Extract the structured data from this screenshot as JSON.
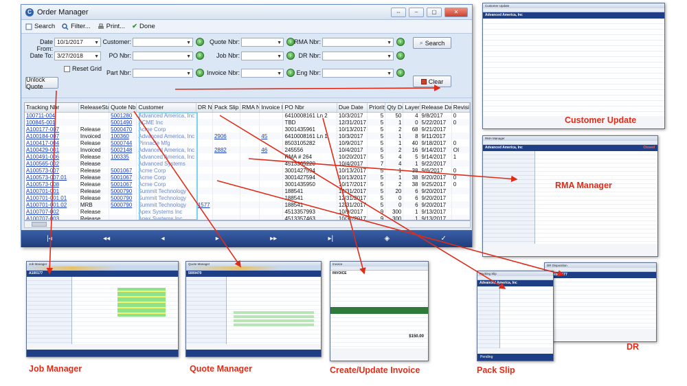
{
  "window": {
    "title": "Order Manager"
  },
  "toolbar": {
    "search": "Search",
    "filter": "Filter...",
    "print": "Print...",
    "done": "Done"
  },
  "filters": {
    "date_from_label": "Date From:",
    "date_from": "10/1/2017",
    "date_to_label": "Date To:",
    "date_to": "3/27/2018",
    "reset_grid": "Reset Grid",
    "customer_label": "Customer:",
    "po_label": "PO Nbr:",
    "part_label": "Part Nbr:",
    "quote_label": "Quote Nbr:",
    "job_label": "Job Nbr:",
    "invoice_label": "Invoice Nbr:",
    "rma_label": "RMA Nbr:",
    "dr_label": "DR Nbr:",
    "eng_label": "Eng Nbr:"
  },
  "buttons": {
    "unlock_quote": "Unlock Quote",
    "search": "Search",
    "clear": "Clear"
  },
  "grid": {
    "columns": [
      "Tracking Nbr",
      "ReleaseStatus",
      "Quote Nbr",
      "Customer",
      "DR Nbr",
      "Pack Slip Nbr",
      "RMA Nbr",
      "Invoice Nbr",
      "PO Nbr",
      "Due Date",
      "Priority",
      "Qty Due",
      "Layers",
      "Release Date",
      "Revision"
    ],
    "rows": [
      [
        "100711-004",
        "",
        "5001280",
        "Advanced America, Inc",
        "",
        "",
        "",
        "",
        "6410008161 Ln 2",
        "10/3/2017",
        "5",
        "50",
        "4",
        "9/8/2017",
        "0"
      ],
      [
        "100845-001",
        "",
        "5001490",
        "ACME Inc",
        "",
        "",
        "",
        "",
        "TBD",
        "12/31/2017",
        "5",
        "1",
        "0",
        "5/22/2017",
        "0"
      ],
      [
        "A100177-007",
        "Release",
        "5000470",
        "Acme Corp",
        "",
        "",
        "",
        "",
        "3001435961",
        "10/13/2017",
        "5",
        "2",
        "68",
        "9/21/2017",
        ""
      ],
      [
        "A100184-007",
        "Invoiced",
        "100360",
        "Advanced America, Inc",
        "",
        "2906",
        "",
        "45",
        "6410008161 Ln 1",
        "10/3/2017",
        "5",
        "1",
        "8",
        "9/11/2017",
        ""
      ],
      [
        "A100417-004",
        "Release",
        "5000744",
        "Pinnacle Mfg",
        "",
        "",
        "",
        "",
        "8503105282",
        "10/9/2017",
        "5",
        "1",
        "40",
        "9/18/2017",
        "0"
      ],
      [
        "A100429-001",
        "Invoiced",
        "5002148",
        "Advanced America, Inc",
        "",
        "2882",
        "",
        "46",
        "245556",
        "10/4/2017",
        "5",
        "2",
        "16",
        "9/14/2017",
        "OI"
      ],
      [
        "A100491-006",
        "Release",
        "100335",
        "Advanced America, Inc",
        "",
        "",
        "",
        "",
        "RMA # 264",
        "10/20/2017",
        "5",
        "4",
        "5",
        "9/14/2017",
        "1"
      ],
      [
        "A100565-002",
        "Release",
        "",
        "Advanced Systems",
        "",
        "",
        "",
        "",
        "4513365220",
        "10/4/2017",
        "7",
        "4",
        "1",
        "9/22/2017",
        ""
      ],
      [
        "A100573-007",
        "Release",
        "5001067",
        "Acme Corp",
        "",
        "",
        "",
        "",
        "3001427594",
        "10/13/2017",
        "5",
        "1",
        "38",
        "9/6/2017",
        "0"
      ],
      [
        "A100573-007.01",
        "Release",
        "5001067",
        "Acme Corp",
        "",
        "",
        "",
        "",
        "3001427594",
        "10/13/2017",
        "5",
        "1",
        "38",
        "9/20/2017",
        "0"
      ],
      [
        "A100573-008",
        "Release",
        "5001067",
        "Acme Corp",
        "",
        "",
        "",
        "",
        "3001435950",
        "10/17/2017",
        "5",
        "2",
        "38",
        "9/25/2017",
        "0"
      ],
      [
        "A100701-001",
        "Release",
        "5000790",
        "Summit Technology",
        "",
        "",
        "",
        "",
        "188541",
        "12/31/2017",
        "5",
        "20",
        "6",
        "9/20/2017",
        ""
      ],
      [
        "A100701-001.01",
        "Release",
        "5000790",
        "Summit Technology",
        "",
        "",
        "",
        "",
        "188541",
        "12/31/2017",
        "5",
        "0",
        "6",
        "9/20/2017",
        ""
      ],
      [
        "A100701-001.02",
        "MRB",
        "5000790",
        "Summit Technology",
        "1577",
        "",
        "",
        "",
        "188541",
        "12/31/2017",
        "5",
        "0",
        "6",
        "9/20/2017",
        ""
      ],
      [
        "A100707-002",
        "Release",
        "",
        "Apex Systems Inc",
        "",
        "",
        "",
        "",
        "4513357993",
        "10/9/2017",
        "9",
        "300",
        "1",
        "9/13/2017",
        ""
      ],
      [
        "A100707-003",
        "Release",
        "",
        "Apex Systems Inc",
        "",
        "",
        "",
        "",
        "4513357463",
        "10/31/2017",
        "9",
        "300",
        "1",
        "9/13/2017",
        ""
      ],
      [
        "A100711-002",
        "Cancelled",
        "5001280",
        "Advanced America, Inc",
        "",
        "",
        "",
        "",
        "1049",
        "12/29/2017",
        "5",
        "1",
        "0",
        "8/24/2017",
        "1"
      ]
    ]
  },
  "nav": {
    "first": "|◂",
    "prev": "◂◂",
    "back": "◂",
    "play": "▸",
    "next": "▸▸",
    "last": "▸|",
    "check": "✓",
    "tag": "◈"
  },
  "thumbnails": {
    "customer_update": {
      "title": "Customer Update",
      "header": "Advanced America, Inc"
    },
    "rma_manager": {
      "title": "RMA Manager",
      "header": "Advanced America, Inc",
      "status": "Closed"
    },
    "job_manager": {
      "title": "Job Manager",
      "header": "A100177"
    },
    "quote_manager": {
      "title": "Quote Manager",
      "header": "5000470"
    },
    "invoice": {
      "title": "Invoice",
      "header": "INVOICE",
      "total": "$150.00"
    },
    "pack_slip": {
      "title": "Packing Slip",
      "header": "Advanced America, Inc",
      "status": "Pending"
    },
    "dr": {
      "title": "DR Disposition",
      "header": "DR Nbr 1577"
    }
  },
  "captions": {
    "customer_update": "Customer Update",
    "rma_manager": "RMA Manager",
    "job_manager": "Job Manager",
    "quote_manager": "Quote Manager",
    "invoice": "Create/Update Invoice",
    "pack_slip": "Pack Slip",
    "dr": "DR"
  },
  "colors": {
    "arrow": "#e02b17",
    "header_bar": "#1e3f85",
    "link": "#1a3fc0"
  }
}
